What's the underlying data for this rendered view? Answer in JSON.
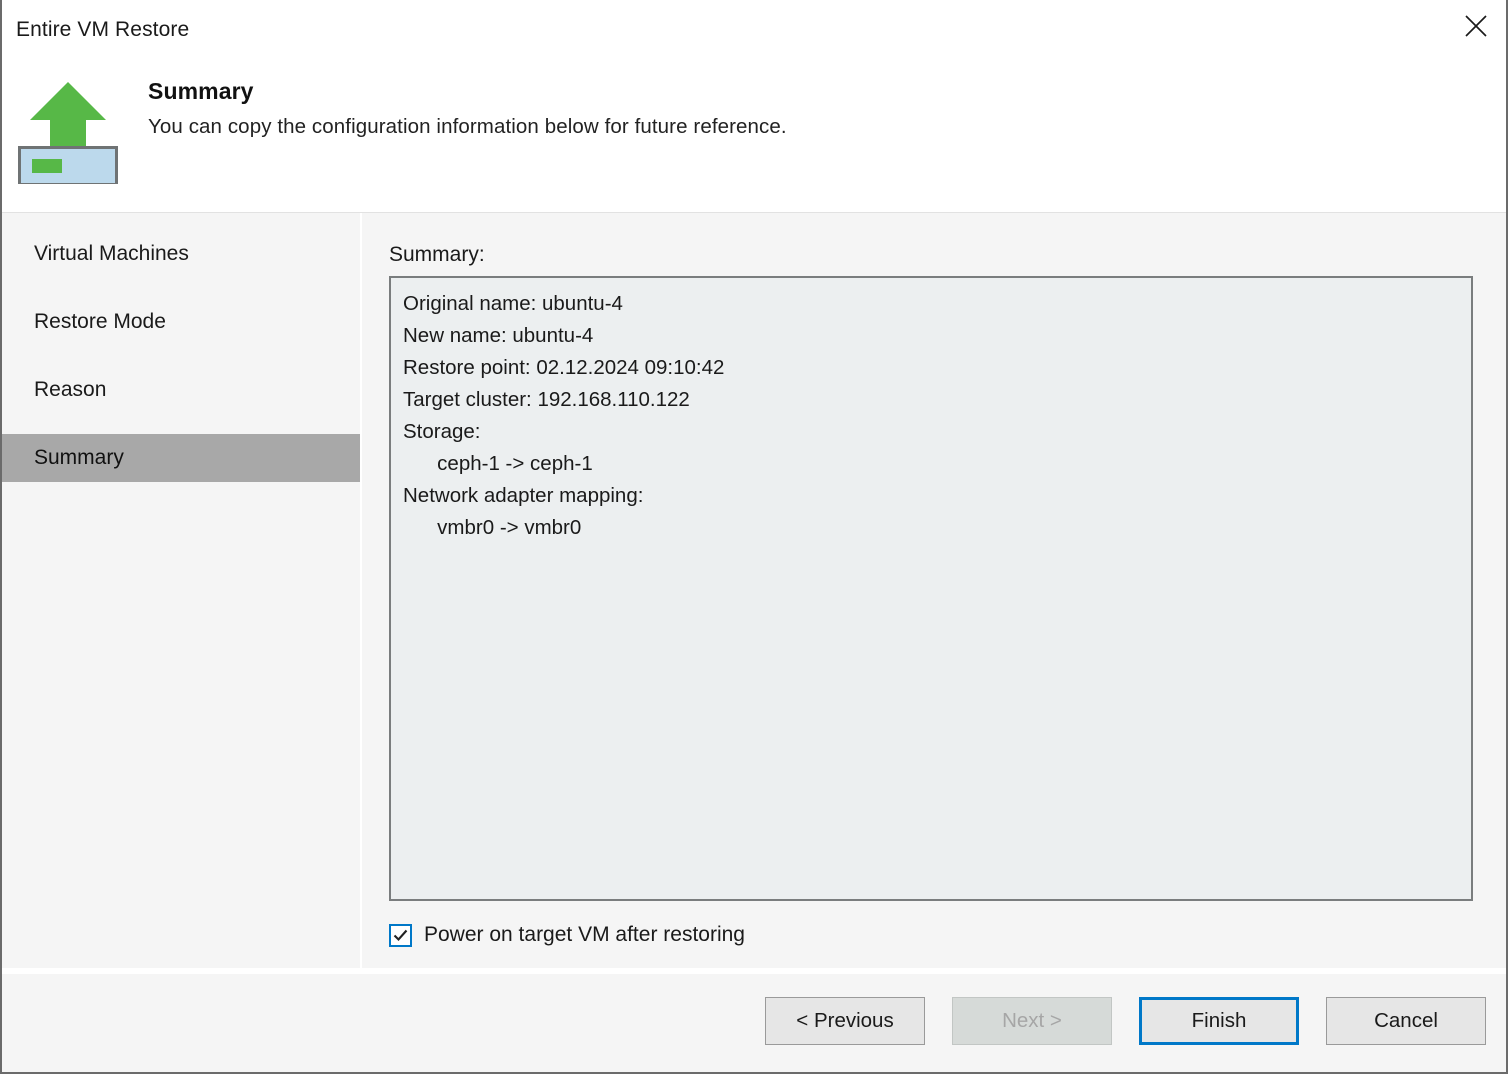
{
  "window": {
    "title": "Entire VM Restore",
    "close_icon": "close-icon"
  },
  "header": {
    "icon": "vm-restore-upload-icon",
    "title": "Summary",
    "subtitle": "You can copy the configuration information below for future reference."
  },
  "sidebar": {
    "items": [
      {
        "label": "Virtual Machines",
        "selected": false
      },
      {
        "label": "Restore Mode",
        "selected": false
      },
      {
        "label": "Reason",
        "selected": false
      },
      {
        "label": "Summary",
        "selected": true
      }
    ]
  },
  "content": {
    "summary_label": "Summary:",
    "summary_text": "Original name: ubuntu-4\nNew name: ubuntu-4\nRestore point: 02.12.2024 09:10:42\nTarget cluster: 192.168.110.122\nStorage:\n      ceph-1 -> ceph-1\nNetwork adapter mapping:\n      vmbr0 -> vmbr0",
    "summary_fields": {
      "original_name": "ubuntu-4",
      "new_name": "ubuntu-4",
      "restore_point": "02.12.2024 09:10:42",
      "target_cluster": "192.168.110.122",
      "storage_mapping": "ceph-1 -> ceph-1",
      "network_adapter_mapping": "vmbr0 -> vmbr0"
    },
    "power_on_checkbox": {
      "label": "Power on target VM after restoring",
      "checked": true
    }
  },
  "footer": {
    "buttons": [
      {
        "label": "< Previous",
        "state": "enabled"
      },
      {
        "label": "Next >",
        "state": "disabled"
      },
      {
        "label": "Finish",
        "state": "focused"
      },
      {
        "label": "Cancel",
        "state": "enabled"
      }
    ]
  },
  "colors": {
    "accent_blue": "#0078c8",
    "icon_green": "#57b847",
    "icon_blue": "#bcd9ec",
    "selected_gray": "#a8a8a8",
    "body_gray": "#f5f5f5",
    "textbox_bg": "#eceff0"
  }
}
